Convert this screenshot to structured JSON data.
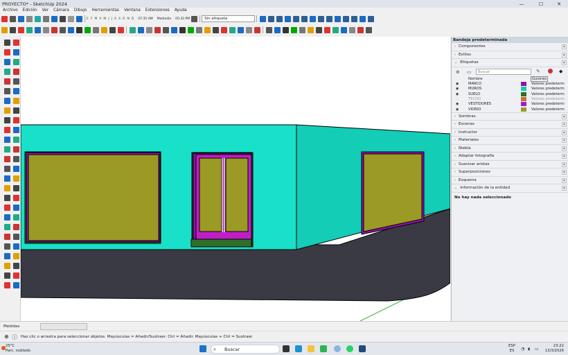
{
  "window": {
    "title": "PROYECTO* - SketchUp 2024",
    "minimize": "—",
    "maximize": "☐",
    "close": "✕"
  },
  "menu": [
    "Archivo",
    "Edición",
    "Ver",
    "Cámara",
    "Dibujo",
    "Herramientas",
    "Ventana",
    "Extensiones",
    "Ayuda"
  ],
  "shadow_toolbar": {
    "months": [
      "E",
      "F",
      "M",
      "A",
      "M",
      "J",
      "J",
      "A",
      "S",
      "O",
      "N",
      "D"
    ],
    "time_start": "07:35 AM",
    "midday": "Mediodía",
    "time_end": "05:33 PM"
  },
  "tag_dropdown": {
    "value": "Sin etiqueta"
  },
  "tray": {
    "title": "Bandeja predeterminada",
    "sections_top": [
      "Componentes",
      "Estilos"
    ],
    "tags_title": "Etiquetas",
    "search_placeholder": "Buscar",
    "col_name": "Nombre",
    "col_dash": "Guiones",
    "tags": [
      {
        "name": "MARCO",
        "color": "#8e13a8",
        "dash": "Valores predeterm"
      },
      {
        "name": "MUROS",
        "color": "#19c9b1",
        "dash": "Valores predeterm"
      },
      {
        "name": "SUELO",
        "color": "#2f6f2a",
        "dash": "Valores predeterm"
      },
      {
        "name": "TECHO",
        "color": "#c1732a",
        "dash": "Valores predeterm",
        "hidden": true
      },
      {
        "name": "VESTIDORES",
        "color": "#a21ac8",
        "dash": "Valores predeterm"
      },
      {
        "name": "VIDRIO",
        "color": "#9a9a24",
        "dash": "Valores predeterm"
      }
    ],
    "sections_bottom": [
      "Sombras",
      "Escenas",
      "Instructor",
      "Materiales",
      "Niebla",
      "Adaptar fotografía",
      "Suavizar aristas",
      "Superposiciones",
      "Esquema"
    ],
    "entity_title": "Información de la entidad",
    "entity_text": "No hay nada seleccionado"
  },
  "measures_label": "Medidas",
  "status_text": "Haz clic o arrastra para seleccionar objetos. Mayúsculas = Añadir/Sustraer. Ctrl = Añadir. Mayúsculas + Ctrl = Sustraer.",
  "taskbar": {
    "temp": "25°C",
    "weather": "Parc. nublado",
    "search": "Buscar",
    "lang1": "ESP",
    "lang2": "ES",
    "time": "23:22",
    "date": "13/3/2026"
  },
  "colors": {
    "wall": "#19e0c8",
    "wall_side": "#13cdb6",
    "glass": "#9a9a24",
    "frame": "#8e13a8",
    "door": "#c01ec8",
    "ground": "#3a3a45"
  }
}
